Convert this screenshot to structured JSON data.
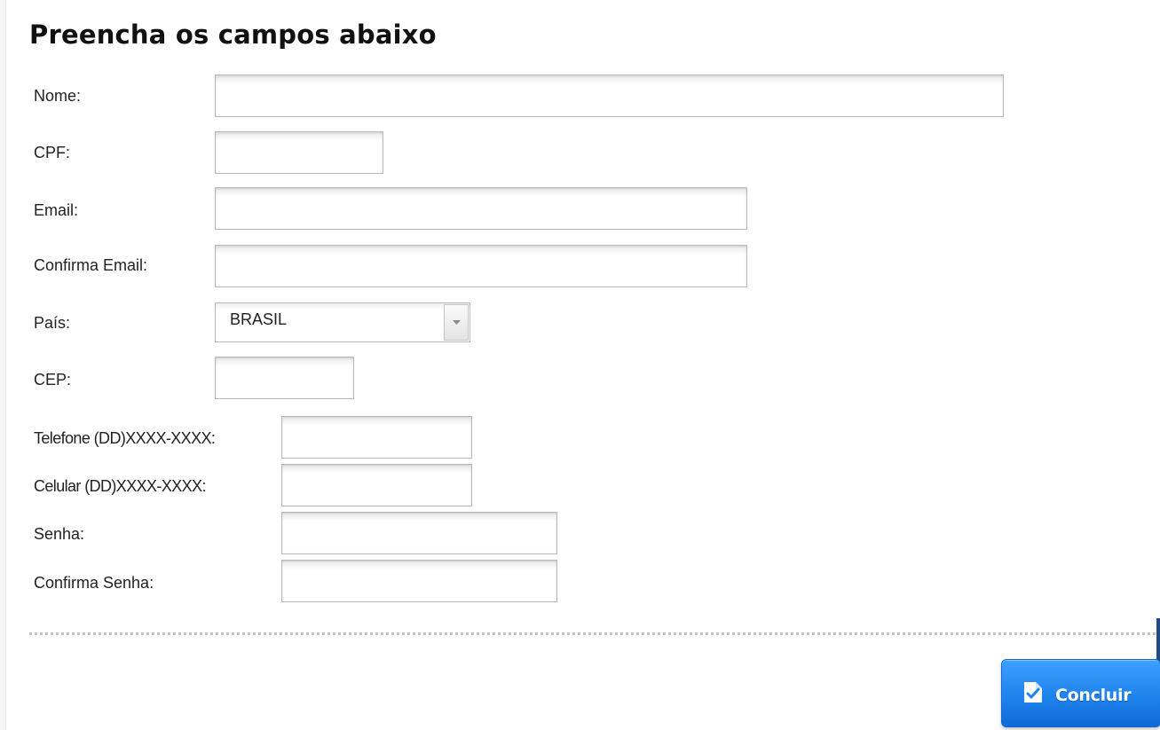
{
  "form": {
    "title": "Preencha os campos abaixo",
    "fields": {
      "nome": {
        "label": "Nome:",
        "value": ""
      },
      "cpf": {
        "label": "CPF:",
        "value": ""
      },
      "email": {
        "label": "Email:",
        "value": ""
      },
      "confirma_email": {
        "label": "Confirma Email:",
        "value": ""
      },
      "pais": {
        "label": "País:",
        "selected": "BRASIL"
      },
      "cep": {
        "label": "CEP:",
        "value": ""
      },
      "telefone": {
        "label": "Telefone (DD)XXXX-XXXX:",
        "value": ""
      },
      "celular": {
        "label": "Celular (DD)XXXX-XXXX:",
        "value": ""
      },
      "senha": {
        "label": "Senha:",
        "value": ""
      },
      "confirma_senha": {
        "label": "Confirma Senha:",
        "value": ""
      }
    },
    "submit": {
      "label": "Concluir",
      "icon": "document-check-icon"
    }
  },
  "colors": {
    "button_primary": "#1f83ee",
    "divider": "#c4c4c4",
    "side_mark": "#1e4a86"
  }
}
